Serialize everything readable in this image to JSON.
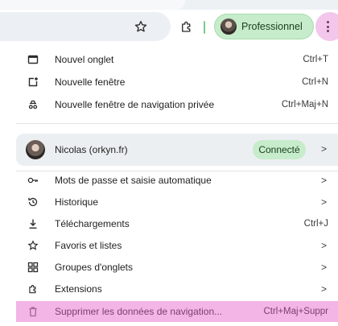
{
  "toolbar": {
    "profile_chip_label": "Professionnel",
    "icons": [
      "star-icon",
      "extensions-icon",
      "menu-icon"
    ],
    "accent": "#c6eccb",
    "menu_button_color": "#f3c6ec"
  },
  "menu": {
    "new_items": [
      {
        "label": "Nouvel onglet",
        "shortcut": "Ctrl+T",
        "icon": "new-tab-icon"
      },
      {
        "label": "Nouvelle fenêtre",
        "shortcut": "Ctrl+N",
        "icon": "new-window-icon"
      },
      {
        "label": "Nouvelle fenêtre de navigation privée",
        "shortcut": "Ctrl+Maj+N",
        "icon": "incognito-icon"
      }
    ],
    "profile": {
      "name": "Nicolas (orkyn.fr)",
      "status": "Connecté"
    },
    "items": [
      {
        "label": "Mots de passe et saisie automatique",
        "icon": "key-icon"
      },
      {
        "label": "Historique",
        "icon": "history-icon"
      },
      {
        "label": "Téléchargements",
        "shortcut": "Ctrl+J",
        "icon": "download-icon"
      },
      {
        "label": "Favoris et listes",
        "icon": "star-icon"
      },
      {
        "label": "Groupes d'onglets",
        "icon": "tab-groups-icon"
      },
      {
        "label": "Extensions",
        "icon": "extensions-icon"
      }
    ],
    "danger": {
      "label": "Supprimer les données de navigation...",
      "shortcut": "Ctrl+Maj+Suppr",
      "icon": "trash-icon",
      "color": "#f2b5e6"
    }
  }
}
